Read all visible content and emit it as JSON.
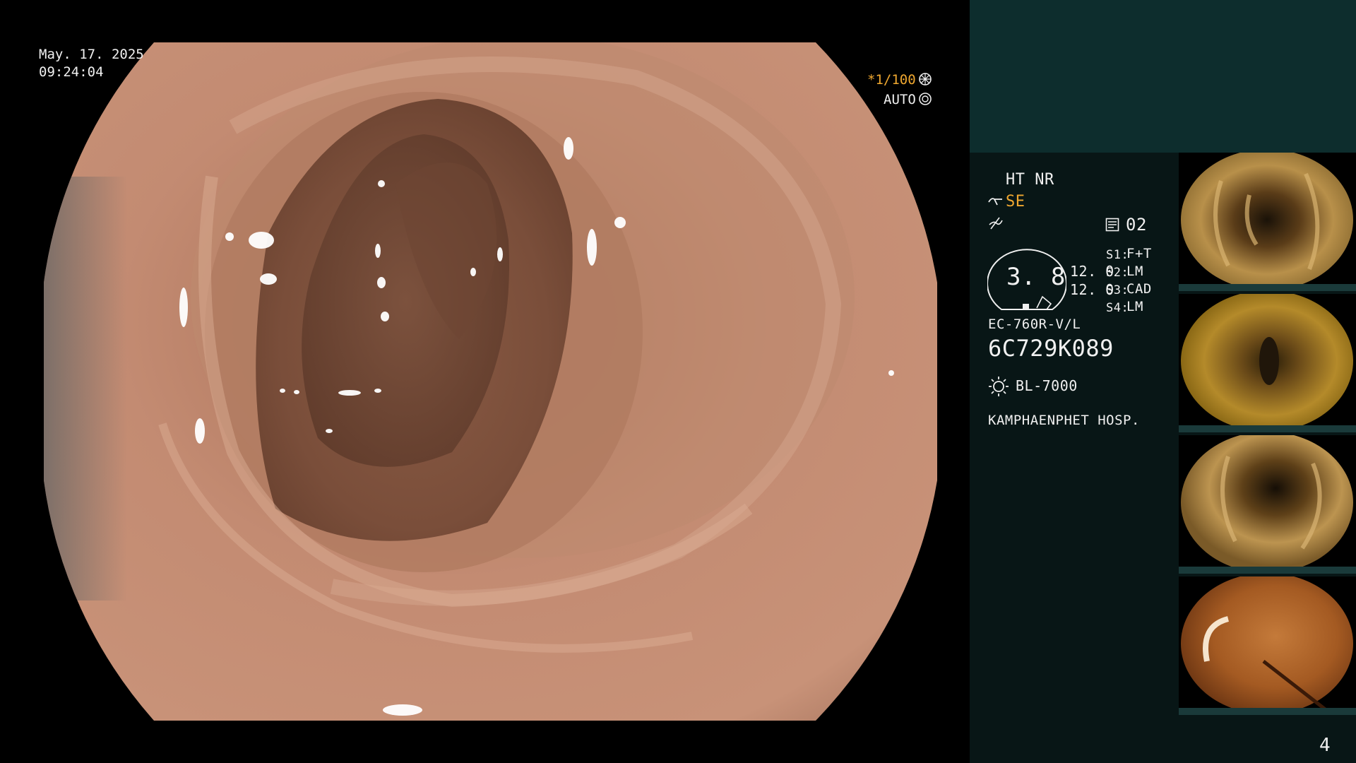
{
  "overlay": {
    "date": "May. 17. 2025",
    "time": "09:24:04",
    "shutter": "*1/100",
    "iris_mode": "AUTO"
  },
  "status": {
    "ht_nr": "HT NR",
    "se": "SE",
    "channel": "02",
    "gauge_value": "3. 8",
    "readout_1": "12. 0",
    "readout_2": "12. 0",
    "s1_label": "S1:",
    "s1_value": "F+T",
    "s2_label": "S2:",
    "s2_value": "LM",
    "s3_label": "S3:",
    "s3_value": "CAD",
    "s4_label": "S4:",
    "s4_value": "LM",
    "scope_model": "EC-760R-V/L",
    "scope_serial": "6C729K089",
    "light_source": "BL-7000",
    "hospital": "KAMPHAENPHET HOSP.",
    "page_number": "4"
  },
  "colors": {
    "panel_background": "#081616",
    "panel_top": "#0d2d2d",
    "accent_orange": "#f0a830",
    "text": "#e8e8e8"
  },
  "icons": {
    "shutter": "aperture-icon",
    "iris": "iris-icon",
    "se": "filter-icon",
    "enhance": "squiggle-icon",
    "channel": "memo-icon",
    "light": "sun-icon"
  }
}
